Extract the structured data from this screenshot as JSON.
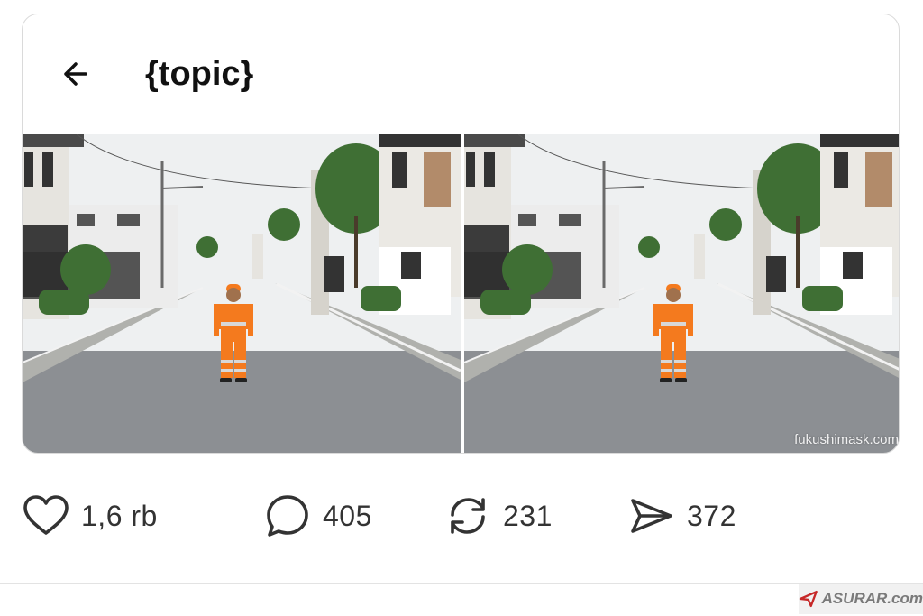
{
  "header": {
    "title": "{topic}",
    "back_icon": "arrow-left-icon"
  },
  "post": {
    "image_watermark": "fukushimask.com",
    "colors": {
      "vest": "#f47a1e",
      "reflective": "#d8d8d8",
      "road": "#8c8f93",
      "sky": "#eef0f1",
      "foliage": "#3f6f34"
    }
  },
  "actions": {
    "likes": {
      "icon": "heart-icon",
      "count": "1,6 rb"
    },
    "comments": {
      "icon": "comment-bubble-icon",
      "count": "405"
    },
    "reposts": {
      "icon": "repost-icon",
      "count": "231"
    },
    "shares": {
      "icon": "send-icon",
      "count": "372"
    }
  },
  "footer": {
    "logo_text": "ASURAR.com"
  }
}
